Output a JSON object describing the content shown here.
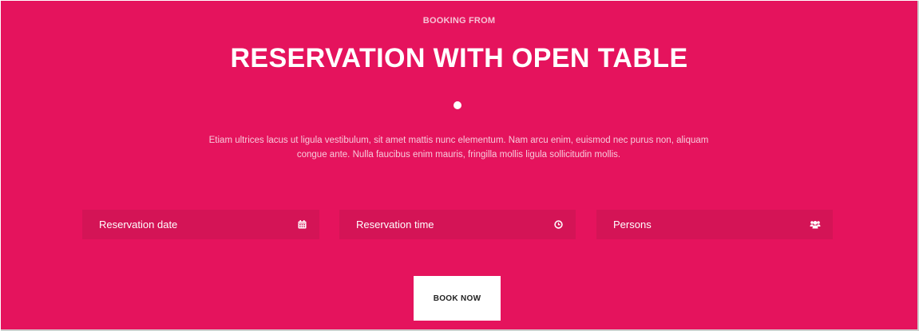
{
  "header": {
    "eyebrow": "BOOKING FROM",
    "title": "RESERVATION WITH OPEN TABLE",
    "description": "Etiam ultrices lacus ut ligula vestibulum, sit amet mattis nunc elementum. Nam arcu enim, euismod nec purus non, aliquam congue ante. Nulla faucibus enim mauris, fringilla mollis ligula sollicitudin mollis."
  },
  "form": {
    "fields": [
      {
        "label": "Reservation date",
        "icon": "calendar-icon"
      },
      {
        "label": "Reservation time",
        "icon": "clock-icon"
      },
      {
        "label": "Persons",
        "icon": "users-icon"
      }
    ],
    "submit_label": "BOOK NOW"
  },
  "colors": {
    "background": "#e5135d",
    "field_background": "#d41456",
    "button_background": "#ffffff",
    "text": "#ffffff"
  }
}
